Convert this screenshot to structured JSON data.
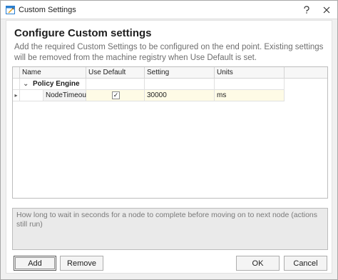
{
  "window": {
    "title": "Custom Settings",
    "help_icon": "help-icon",
    "close_icon": "close-icon"
  },
  "main": {
    "heading": "Configure Custom settings",
    "description": "Add the required Custom Settings to be configured on the end point. Existing settings will be removed from the machine registry when Use Default is set."
  },
  "grid": {
    "columns": [
      "Name",
      "Use Default",
      "Setting",
      "Units"
    ],
    "groups": [
      {
        "label": "Policy Engine",
        "rows": [
          {
            "name": "NodeTimeout",
            "use_default": true,
            "setting": "30000",
            "units": "ms"
          }
        ]
      }
    ]
  },
  "help_text": "How long to wait in seconds for a node to complete before moving on to next node (actions still run)",
  "buttons": {
    "add": "Add",
    "remove": "Remove",
    "ok": "OK",
    "cancel": "Cancel"
  }
}
